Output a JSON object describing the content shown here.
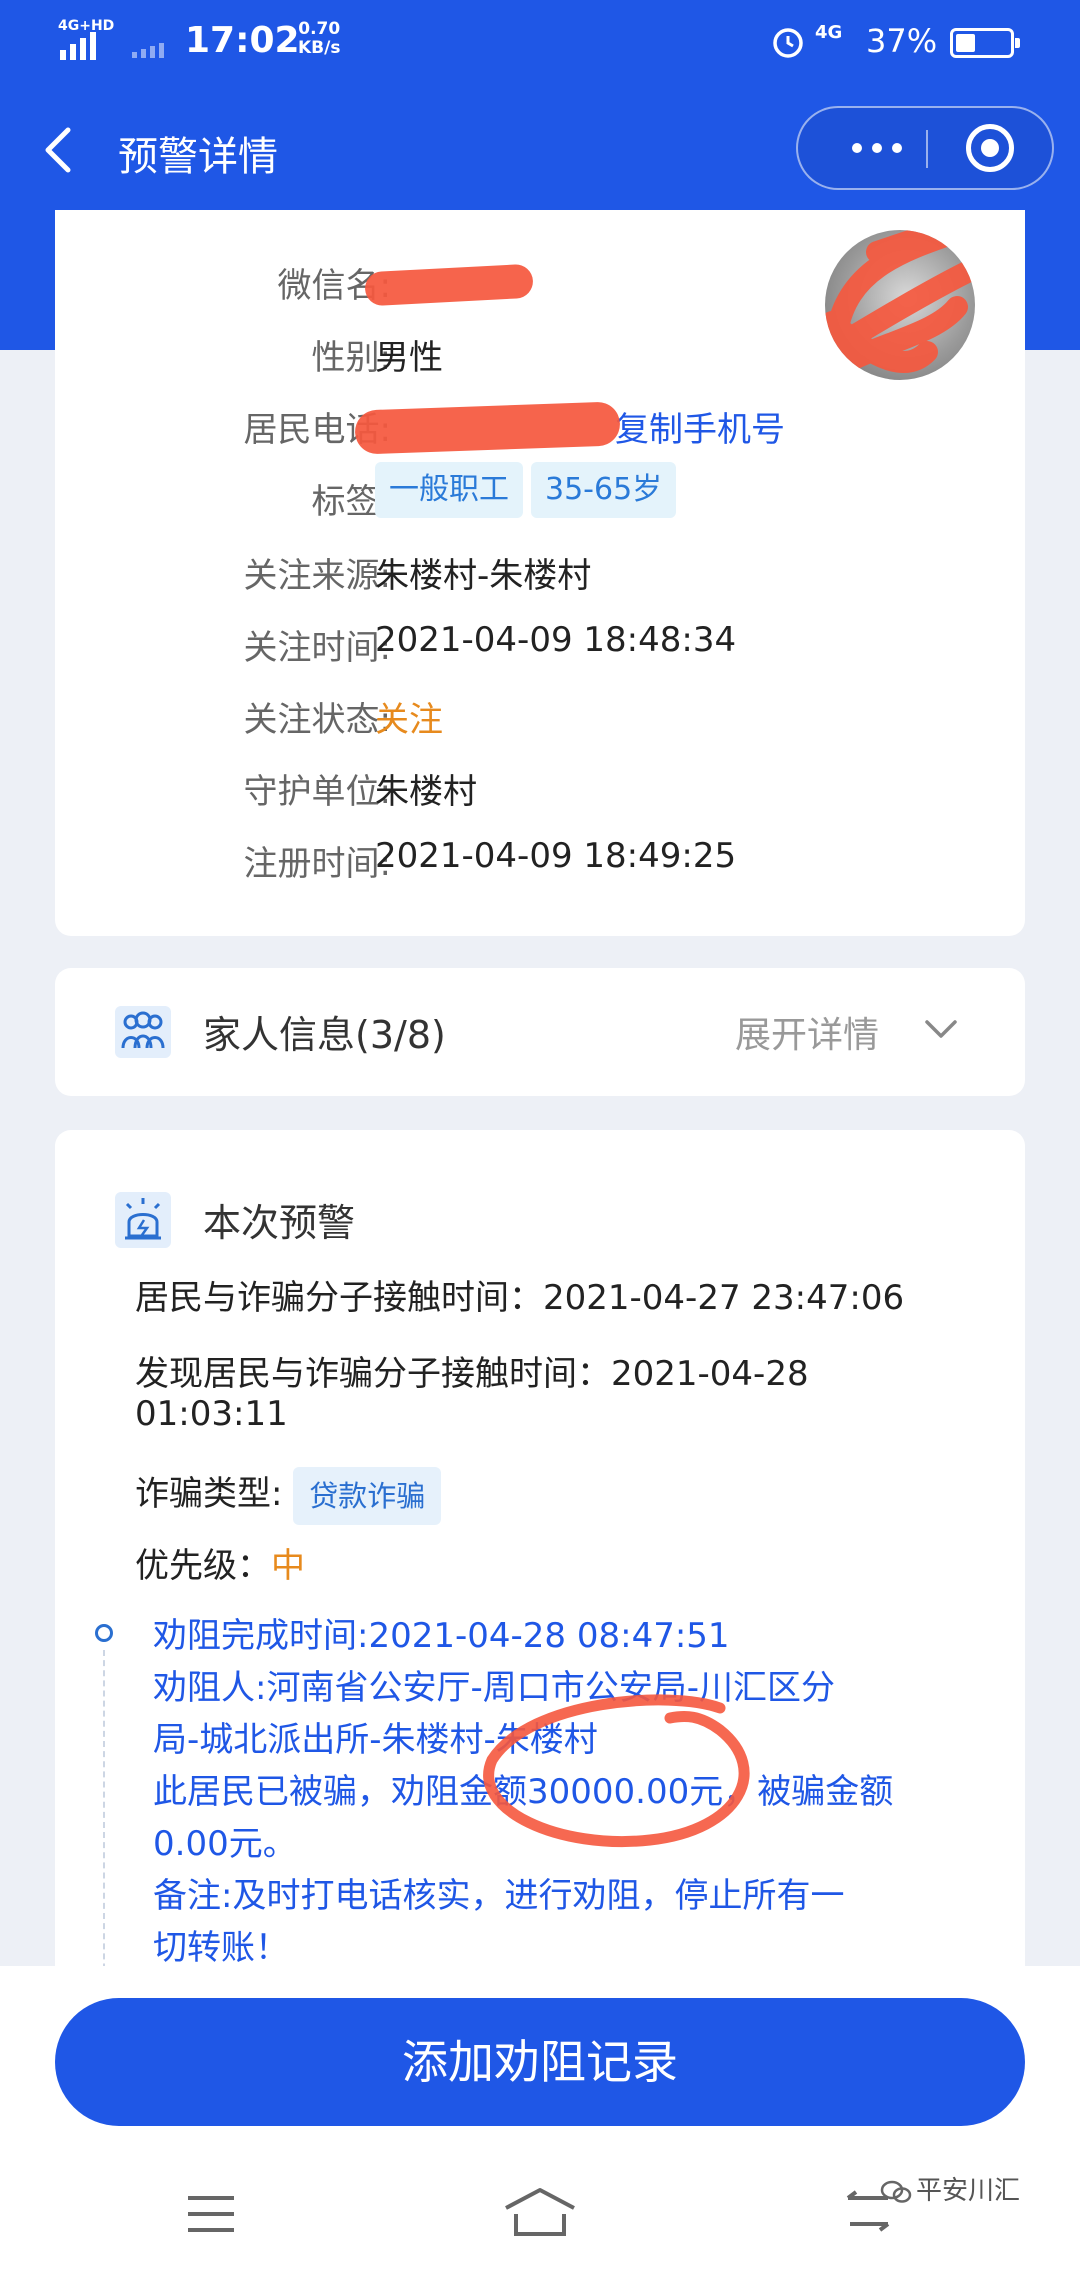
{
  "status_bar": {
    "network": "4G+HD",
    "time": "17:02",
    "speed_value": "0.70",
    "speed_unit": "KB/s",
    "net2": "4G",
    "battery": "37%",
    "battery_level": 0.37
  },
  "header": {
    "title": "预警详情"
  },
  "resident": {
    "rows": [
      {
        "label": "微信名:",
        "value": ""
      },
      {
        "label": "性别:",
        "value": "男性"
      },
      {
        "label": "居民电话:",
        "value": "",
        "action": "复制手机号"
      },
      {
        "label": "标签:",
        "tags": [
          "一般职工",
          "35-65岁"
        ]
      },
      {
        "label": "关注来源:",
        "value": "朱楼村-朱楼村"
      },
      {
        "label": "关注时间:",
        "value": "2021-04-09 18:48:34"
      },
      {
        "label": "关注状态:",
        "value": "关注"
      },
      {
        "label": "守护单位:",
        "value": "朱楼村"
      },
      {
        "label": "注册时间:",
        "value": "2021-04-09 18:49:25"
      }
    ]
  },
  "family": {
    "title": "家人信息",
    "count": "(3/8)",
    "expand": "展开详情"
  },
  "alert": {
    "title": "本次预警",
    "contact_time": "居民与诈骗分子接触时间：2021-04-27 23:47:06",
    "found_time_1": "发现居民与诈骗分子接触时间：2021-04-28",
    "found_time_2": "01:03:11",
    "fraud_type_label": "诈骗类型:",
    "fraud_type": "贷款诈骗",
    "priority_label": "优先级：",
    "priority": "中",
    "timeline": [
      "劝阻完成时间:2021-04-28 08:47:51",
      "劝阻人:河南省公安厅-周口市公安局-川汇区分",
      "局-城北派出所-朱楼村-朱楼村",
      "此居民已被骗，劝阻金额30000.00元，被骗金额",
      "0.00元。",
      "备注:及时打电话核实，进行劝阻，停止所有一",
      "切转账！"
    ]
  },
  "action": {
    "add_record": "添加劝阻记录"
  },
  "watermark": "平安川汇",
  "colors": {
    "brand": "#1f57e6",
    "accent_orange": "#e78a1d",
    "redaction": "#f5583e"
  }
}
